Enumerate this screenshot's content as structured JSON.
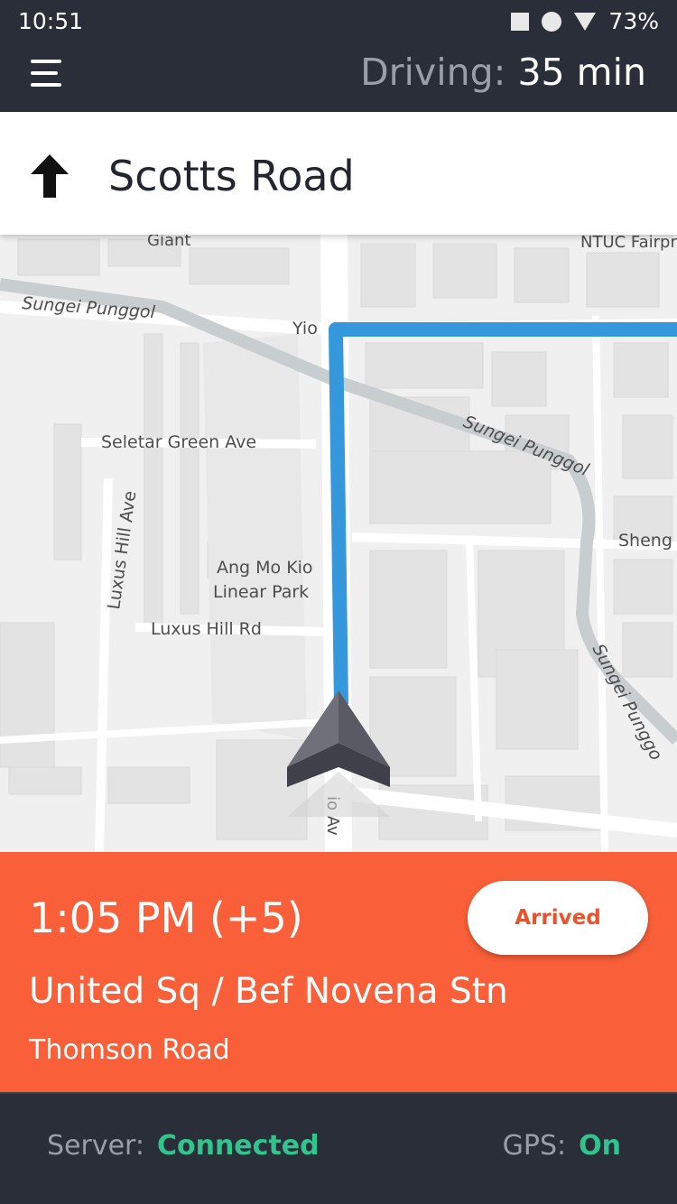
{
  "status_bar": {
    "time": "10:51",
    "battery": "73%",
    "icons": [
      "square-notification-icon",
      "circle-notification-icon",
      "wifi-icon"
    ]
  },
  "header": {
    "menu_icon": "hamburger-icon",
    "driving_label": "Driving:",
    "driving_value": "35 min"
  },
  "instruction": {
    "icon": "arrow-up-icon",
    "street": "Scotts Road"
  },
  "map": {
    "labels": {
      "giant": "Giant",
      "ntuc": "NTUC Fairpr",
      "sungei_punggol_1": "Sungei Punggol",
      "yio": "Yio",
      "sungei_punggol_2": "Sungei Punggol",
      "seletar": "Seletar Green Ave",
      "luxus_ave": "Luxus Hill Ave",
      "amk_park_1": "Ang Mo Kio",
      "amk_park_2": "Linear Park",
      "luxus_rd": "Luxus Hill Rd",
      "sheng": "Sheng",
      "sungei_punggol_3": "Sungei Punggo",
      "io_av": "io Av"
    },
    "route_color": "#3598dc"
  },
  "destination": {
    "eta": "1:05 PM (+5)",
    "arrived_label": "Arrived",
    "stop_name": "United Sq / Bef Novena Stn",
    "road": "Thomson Road",
    "accent": "#f95f38"
  },
  "footer": {
    "server_label": "Server:",
    "server_value": "Connected",
    "gps_label": "GPS:",
    "gps_value": "On",
    "ok_color": "#2fc58c"
  }
}
